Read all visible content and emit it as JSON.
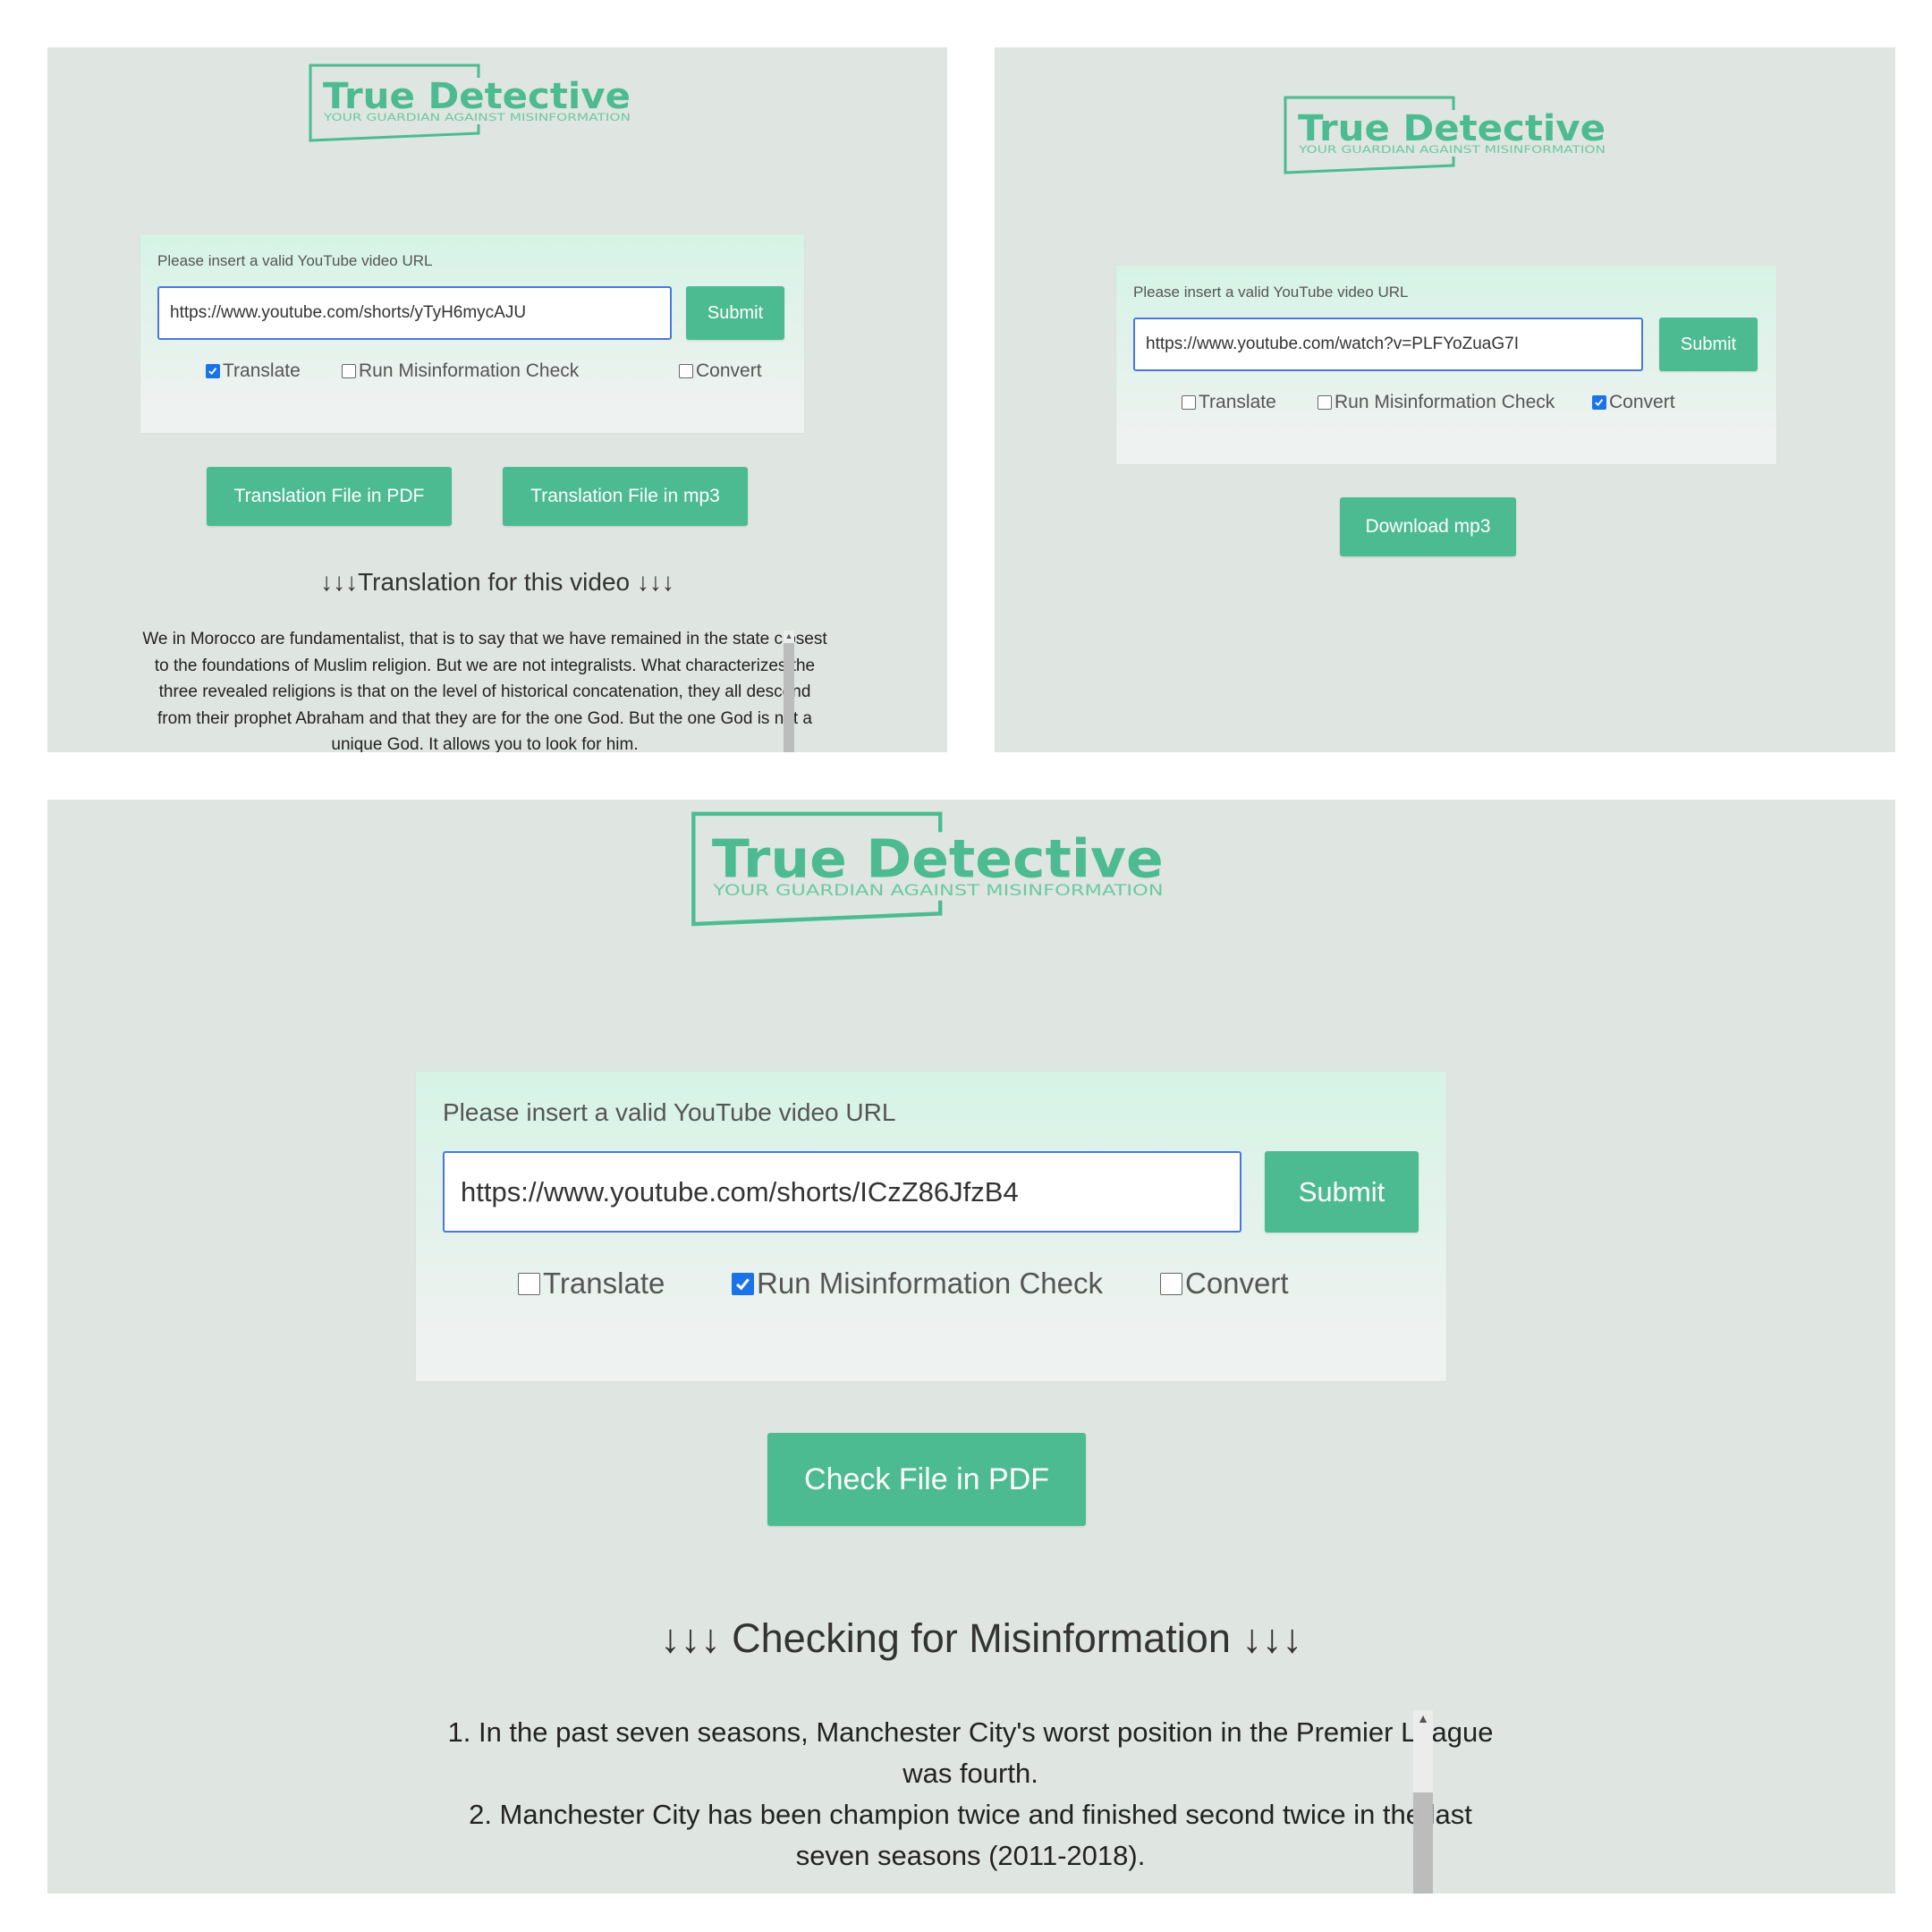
{
  "logo": {
    "title": "True Detective",
    "tagline": "YOUR GUARDIAN AGAINST MISINFORMATION",
    "color": "#4dbb92"
  },
  "colors": {
    "accent": "#4dbb92",
    "panel": "#dfe5e0",
    "input_border": "#4a78d8",
    "checkbox": "#1a73e8"
  },
  "panels": [
    {
      "hint": "Please insert a valid YouTube video URL",
      "url": "https://www.youtube.com/shorts/yTyH6mycAJU",
      "submit": "Submit",
      "options": {
        "translate": "Translate",
        "misinfo": "Run Misinformation Check",
        "convert": "Convert"
      },
      "checked": {
        "translate": true,
        "misinfo": false,
        "convert": false
      },
      "actions": [
        "Translation File in PDF",
        "Translation File in mp3"
      ],
      "heading": "↓↓↓Translation for this video ↓↓↓",
      "body": "We in Morocco are fundamentalist, that is to say that we have remained in the state closest to the foundations of Muslim religion. But we are not integralists. What characterizes the three revealed religions is that on the level of historical concatenation, they all descend from their prophet Abraham and that they are for the one God. But the one God is not a unique God. It allows you to look for him."
    },
    {
      "hint": "Please insert a valid YouTube video URL",
      "url": "https://www.youtube.com/watch?v=PLFYoZuaG7I",
      "submit": "Submit",
      "options": {
        "translate": "Translate",
        "misinfo": "Run Misinformation Check",
        "convert": "Convert"
      },
      "checked": {
        "translate": false,
        "misinfo": false,
        "convert": true
      },
      "actions": [
        "Download mp3"
      ]
    },
    {
      "hint": "Please insert a valid YouTube video URL",
      "url": "https://www.youtube.com/shorts/ICzZ86JfzB4",
      "submit": "Submit",
      "options": {
        "translate": "Translate",
        "misinfo": "Run Misinformation Check",
        "convert": "Convert"
      },
      "checked": {
        "translate": false,
        "misinfo": true,
        "convert": false
      },
      "actions": [
        "Check File in PDF"
      ],
      "heading": "↓↓↓ Checking for Misinformation ↓↓↓",
      "items": [
        "1. In the past seven seasons, Manchester City's worst position in the Premier League was fourth.",
        "2. Manchester City has been champion twice and finished second twice in the last seven seasons (2011-2018)."
      ]
    }
  ]
}
